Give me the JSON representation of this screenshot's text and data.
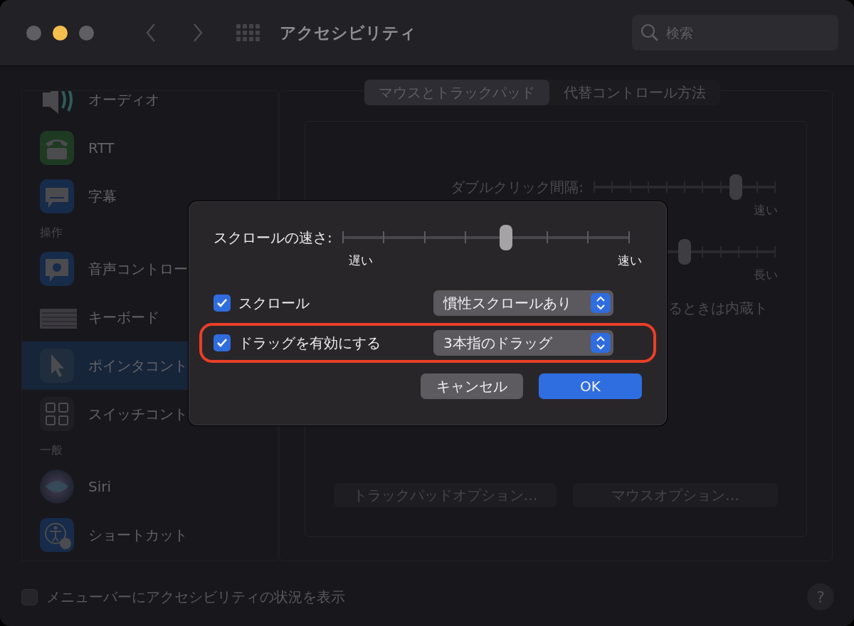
{
  "window": {
    "title": "アクセシビリティ",
    "search": {
      "placeholder": "検索"
    }
  },
  "sidebar": {
    "entries": [
      {
        "kind": "item",
        "label": "オーディオ",
        "selected": false
      },
      {
        "kind": "item",
        "label": "RTT",
        "selected": false
      },
      {
        "kind": "item",
        "label": "字幕",
        "selected": false
      },
      {
        "kind": "header",
        "label": "操作"
      },
      {
        "kind": "item",
        "label": "音声コントロー",
        "selected": false
      },
      {
        "kind": "item",
        "label": "キーボード",
        "selected": false
      },
      {
        "kind": "item",
        "label": "ポインタコント",
        "selected": true
      },
      {
        "kind": "item",
        "label": "スイッチコント",
        "selected": false
      },
      {
        "kind": "header",
        "label": "一般"
      },
      {
        "kind": "item",
        "label": "Siri",
        "selected": false
      },
      {
        "kind": "item",
        "label": "ショートカット",
        "selected": false
      }
    ]
  },
  "panel": {
    "tabs": [
      {
        "label": "マウスとトラックパッド",
        "selected": true
      },
      {
        "label": "代替コントロール方法",
        "selected": false
      }
    ],
    "sliders": [
      {
        "label": "ダブルクリック間隔:",
        "level": 0.78,
        "max_label": "速い"
      },
      {
        "level": 0.5,
        "max_label": "長い"
      }
    ],
    "note": "るときは内蔵ト",
    "buttons": [
      "トラックパッドオプション…",
      "マウスオプション…"
    ]
  },
  "menu_bar_option": {
    "label": "メニューバーにアクセシビリティの状況を表示",
    "checked": false
  },
  "help": "?",
  "dialog": {
    "slider": {
      "label": "スクロールの速さ:",
      "level": 0.57,
      "min_label": "遅い",
      "max_label": "速い"
    },
    "options": [
      {
        "label": "スクロール",
        "checked": true,
        "value": "慣性スクロールあり",
        "highlighted": false
      },
      {
        "label": "ドラッグを有効にする",
        "checked": true,
        "value": "3本指のドラッグ",
        "highlighted": true
      }
    ],
    "buttons": [
      {
        "label": "キャンセル",
        "default": false
      },
      {
        "label": "OK",
        "default": true
      }
    ]
  }
}
